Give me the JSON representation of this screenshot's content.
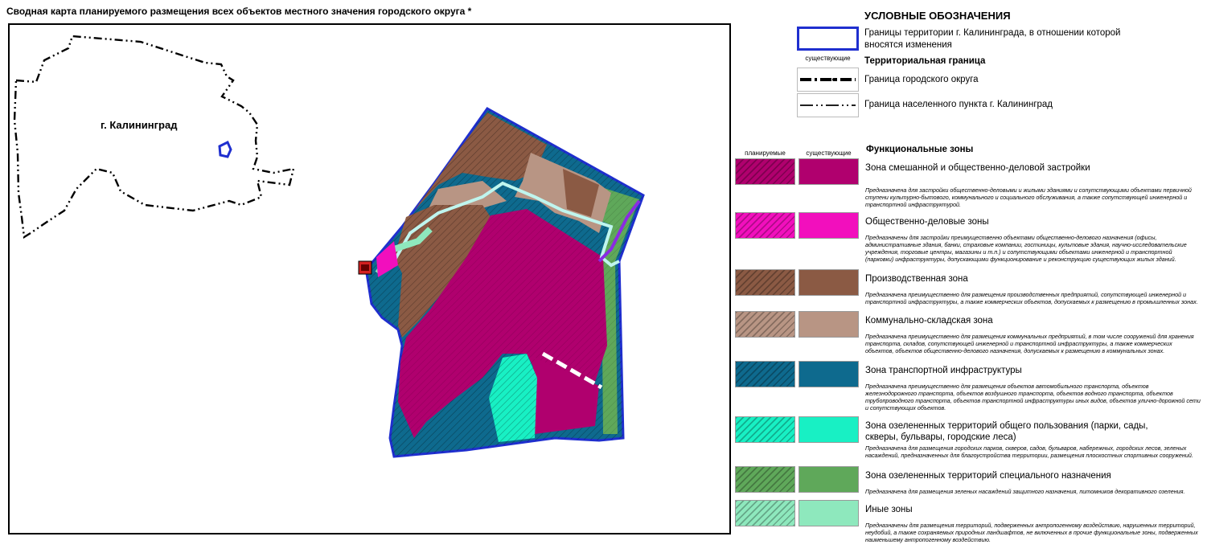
{
  "header": {
    "title": "Сводная карта планируемого размещения всех объектов местного значения городского округа *"
  },
  "map": {
    "city_label": "г. Калининград",
    "colors": {
      "mixed_zone": "#b0006e",
      "business_zone": "#f20fbd",
      "industrial_zone": "#8b5a44",
      "warehouse_zone": "#b89584",
      "transport_zone": "#0e6a8e",
      "park_zone": "#18f0c4",
      "special_green_zone": "#5fa85a",
      "other_zone": "#8ee8bd",
      "change_boundary": "#1f2fcf"
    }
  },
  "legend": {
    "title": "УСЛОВНЫЕ ОБОЗНАЧЕНИЯ",
    "change_boundary_label": "Границы территории г. Калининграда, в отношении которой вносятся изменения",
    "existing_small_label": "существующие",
    "territorial_boundary_title": "Территориальная граница",
    "district_boundary_label": "Граница городского округа",
    "settlement_boundary_label": "Граница населенного пункта г. Калининград",
    "planned_col": "планируемые",
    "existing_col": "существующие",
    "functional_zones_title": "Функциональные зоны",
    "zones": [
      {
        "name": "Зона смешанной и общественно-деловой застройки",
        "desc": "Предназначена для застройки общественно-деловыми и жилыми зданиями и сопутствующими объектами первичной ступени культурно-бытового, коммунального и социального обслуживания, а также сопутствующей инженерной и транспортной инфраструктурой.",
        "color": "#b0006e"
      },
      {
        "name": "Общественно-деловые зоны",
        "desc": "Предназначены для застройки преимущественно объектами общественно-делового назначения (офисы, административные здания, банки, страховые компании, гостиницы, культовые здания, научно-исследовательские учреждения, торговые центры, магазины и т.п.) и сопутствующими объектами инженерной и транспортной (парковки) инфраструктуры, допускающими функционирование и реконструкцию существующих жилых зданий.",
        "color": "#f20fbd"
      },
      {
        "name": "Производственная зона",
        "desc": "Предназначена преимущественно для размещения производственных предприятий, сопутствующей инженерной и транспортной инфраструктуры, а также коммерческих объектов, допускаемых к размещению в промышленных зонах.",
        "color": "#8b5a44"
      },
      {
        "name": "Коммунально-складская зона",
        "desc": "Предназначена преимущественно для размещения коммунальных предприятий, в том числе сооружений для хранения транспорта, складов, сопутствующей инженерной и транспортной инфраструктуры, а также коммерческих объектов, объектов общественно-делового назначения, допускаемых к размещению в коммунальных зонах.",
        "color": "#b89584"
      },
      {
        "name": "Зона транспортной инфраструктуры",
        "desc": "Предназначена преимущественно для размещения объектов автомобильного транспорта, объектов железнодорожного транспорта, объектов воздушного транспорта, объектов водного транспорта, объектов трубопроводного транспорта, объектов транспортной инфраструктуры иных видов, объектов улично-дорожной сети и сопутствующих объектов.",
        "color": "#0e6a8e"
      },
      {
        "name": "Зона озелененных территорий общего пользования (парки, сады, скверы, бульвары, городские леса)",
        "desc": "Предназначена для размещения городских парков, скверов, садов, бульваров, набережных, городских лесов, зеленых насаждений, предназначенных для благоустройства территории, размещения плоскостных спортивных сооружений.",
        "color": "#18f0c4"
      },
      {
        "name": "Зона озелененных территорий специального назначения",
        "desc": "Предназначена для размещения зеленых насаждений защитного назначения, питомников декоративного озеления.",
        "color": "#5fa85a"
      },
      {
        "name": "Иные зоны",
        "desc": "Предназначены для размещения территорий, подверженных антропогенному воздействию, нарушенных территорий, неудобий, а также сохраняемых природных ландшафтов, не включенных в прочие функциональные зоны, подверженных наименьшему антропогенному воздействию.",
        "color": "#8ee8bd"
      }
    ]
  }
}
